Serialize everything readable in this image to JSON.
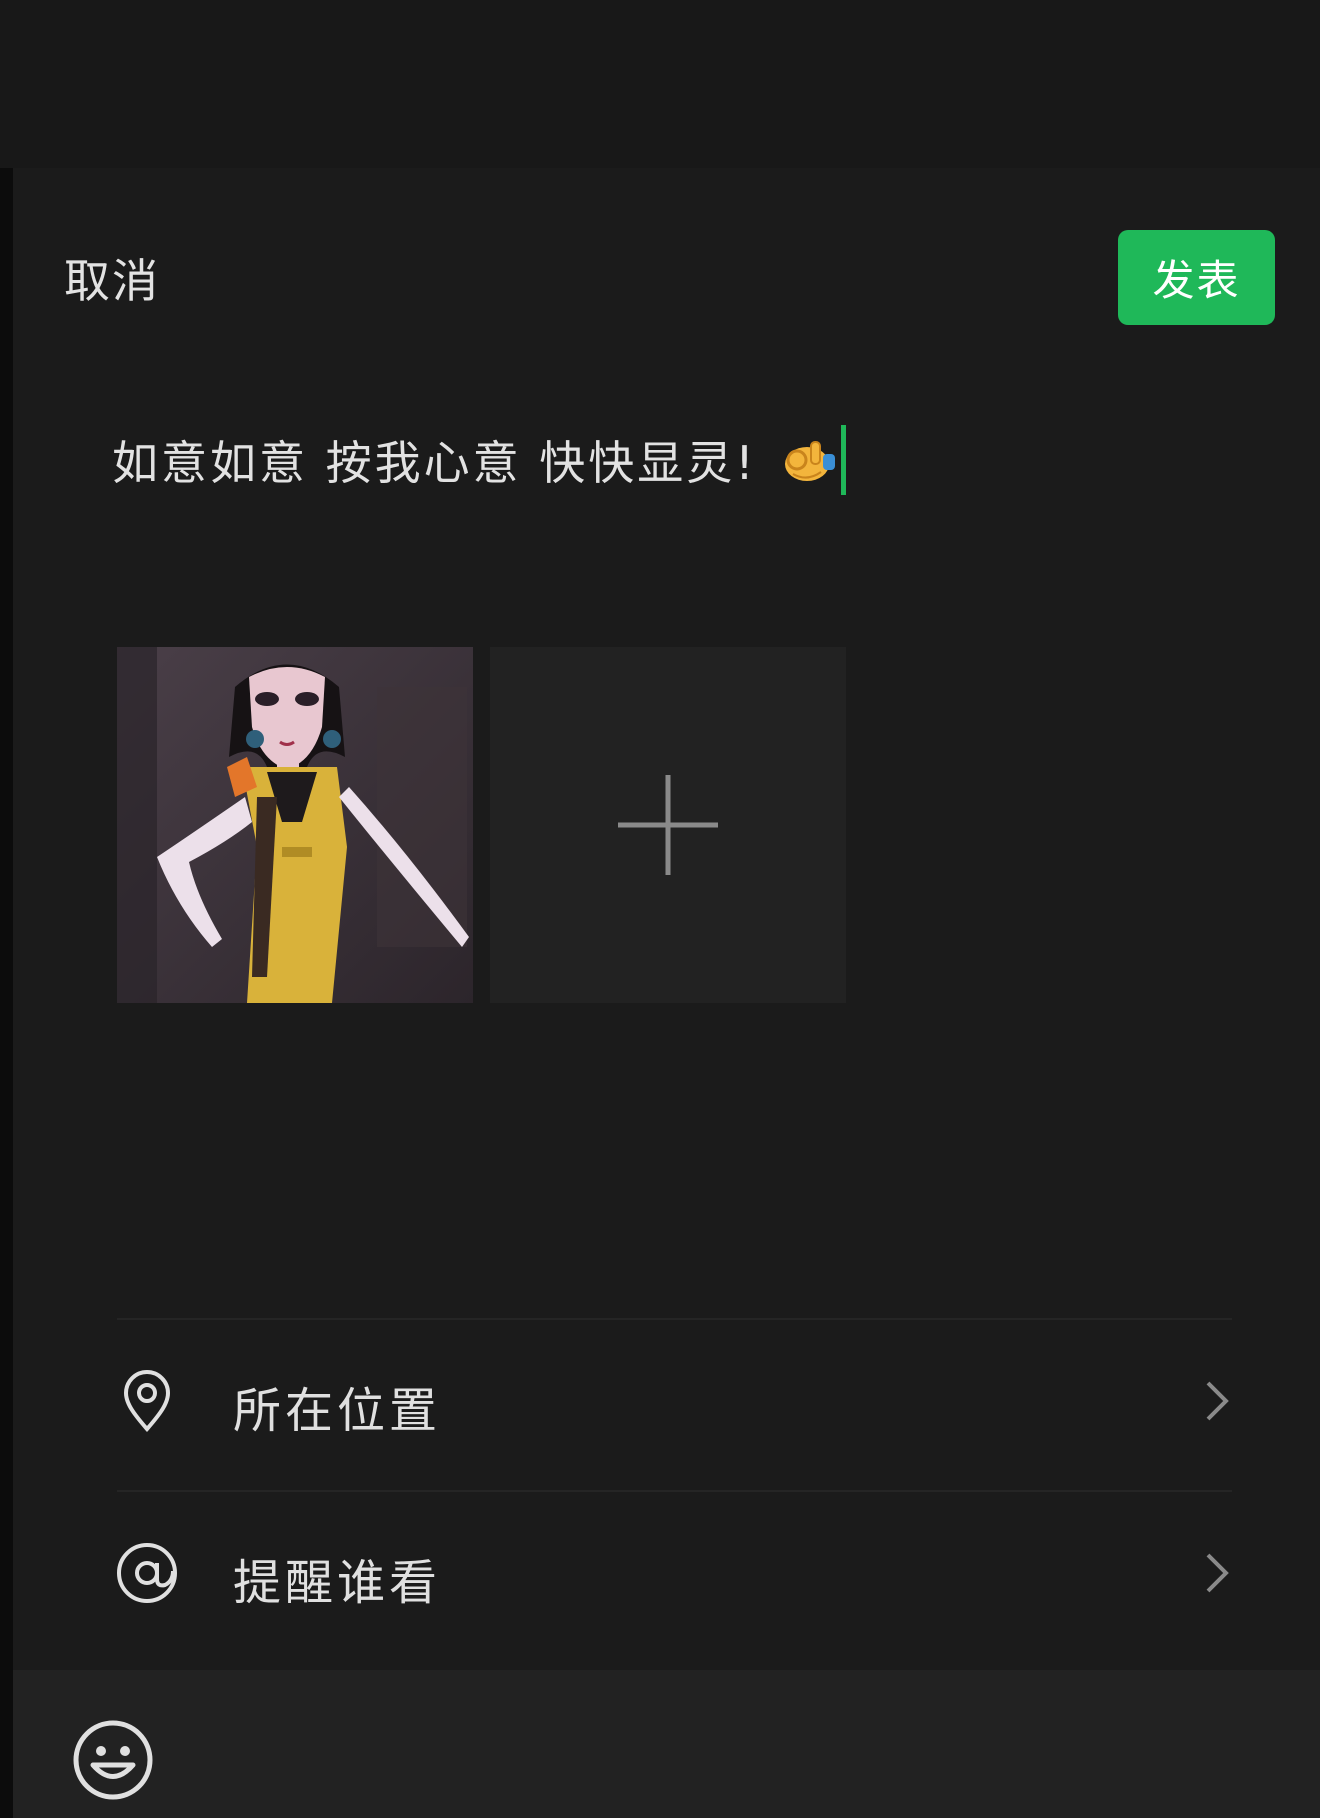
{
  "header": {
    "cancel_label": "取消",
    "publish_label": "发表"
  },
  "compose": {
    "text": "如意如意 按我心意 快快显灵!",
    "trailing_emoji": "ok-hand-emoji"
  },
  "media": {
    "attached_image": "cartoon-woman-in-yellow-dress",
    "add_icon": "plus-icon"
  },
  "options": [
    {
      "icon": "location-pin-icon",
      "label": "所在位置"
    },
    {
      "icon": "at-sign-icon",
      "label": "提醒谁看"
    }
  ],
  "toolbar": {
    "emoji_icon": "smiley-face-icon"
  },
  "colors": {
    "background": "#1b1b1b",
    "accent": "#1fb859",
    "text": "#e2e2e2"
  }
}
